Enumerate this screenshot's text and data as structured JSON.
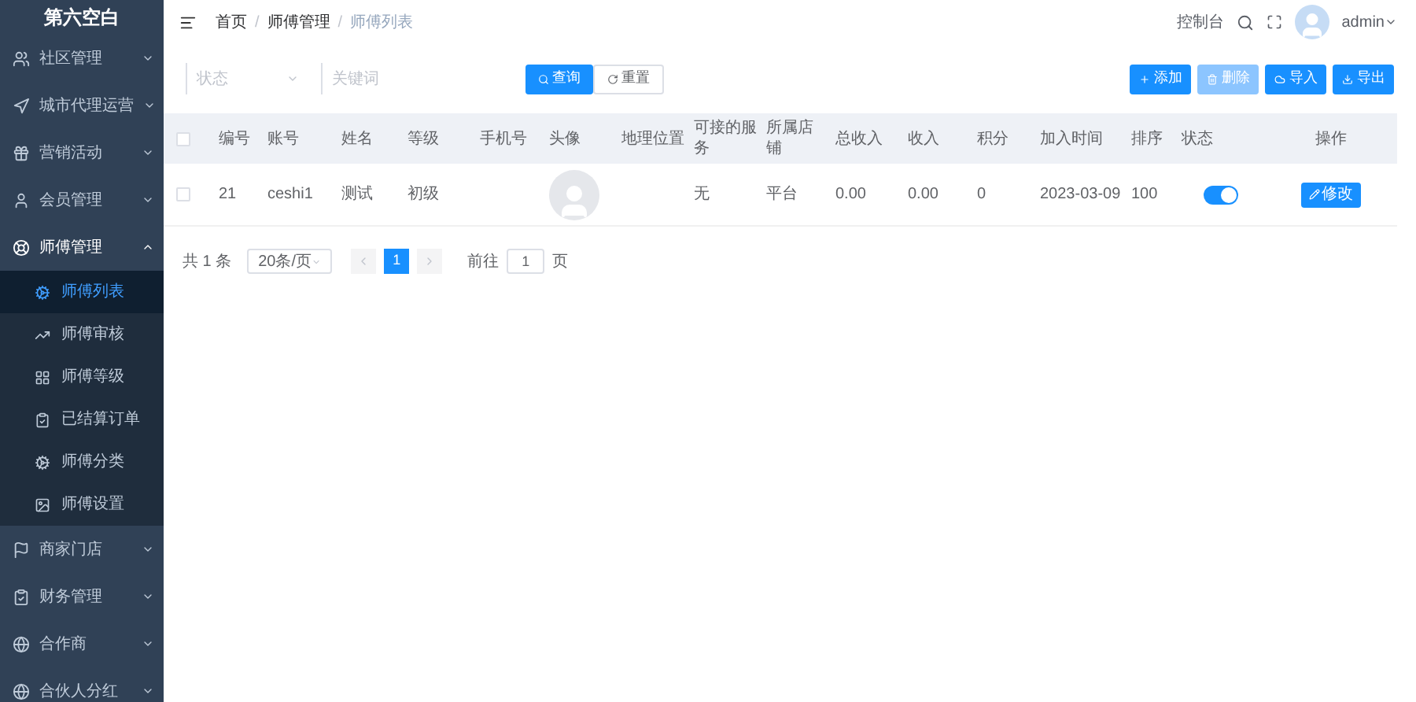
{
  "logo": "第六空白",
  "sidebar": {
    "items": [
      {
        "label": "社区管理",
        "expanded": false
      },
      {
        "label": "城市代理运营",
        "expanded": false
      },
      {
        "label": "营销活动",
        "expanded": false
      },
      {
        "label": "会员管理",
        "expanded": false
      },
      {
        "label": "师傅管理",
        "expanded": true,
        "children": [
          {
            "label": "师傅列表",
            "selected": true
          },
          {
            "label": "师傅审核",
            "selected": false
          },
          {
            "label": "师傅等级",
            "selected": false
          },
          {
            "label": "已结算订单",
            "selected": false
          },
          {
            "label": "师傅分类",
            "selected": false
          },
          {
            "label": "师傅设置",
            "selected": false
          }
        ]
      },
      {
        "label": "商家门店",
        "expanded": false
      },
      {
        "label": "财务管理",
        "expanded": false
      },
      {
        "label": "合作商",
        "expanded": false
      },
      {
        "label": "合伙人分红",
        "expanded": false
      }
    ]
  },
  "breadcrumb": {
    "separator": "/",
    "items": [
      "首页",
      "师傅管理",
      "师傅列表"
    ]
  },
  "header": {
    "console": "控制台",
    "user": "admin"
  },
  "filters": {
    "status_placeholder": "状态",
    "keyword_placeholder": "关键词"
  },
  "search_buttons": [
    {
      "label": "查询",
      "kind": "primary"
    },
    {
      "label": "重置",
      "kind": "plain"
    }
  ],
  "actions": [
    {
      "label": "添加",
      "disabled": false
    },
    {
      "label": "删除",
      "disabled": true
    },
    {
      "label": "导入",
      "disabled": false
    },
    {
      "label": "导出",
      "disabled": false
    }
  ],
  "table": {
    "header_checked": false,
    "columns": [
      "编号",
      "账号",
      "姓名",
      "等级",
      "手机号",
      "头像",
      "地理位置",
      "可接的服务",
      "所属店铺",
      "总收入",
      "收入",
      "积分",
      "加入时间",
      "排序",
      "状态",
      "操作"
    ],
    "rows": [
      {
        "checked": false,
        "cells": [
          {
            "kind": "text",
            "text": "21"
          },
          {
            "kind": "text",
            "text": "ceshi1"
          },
          {
            "kind": "text",
            "text": "测试"
          },
          {
            "kind": "text",
            "text": "初级"
          },
          {
            "kind": "blank"
          },
          {
            "kind": "avatar"
          },
          {
            "kind": "blank"
          },
          {
            "kind": "text",
            "text": "无"
          },
          {
            "kind": "text",
            "text": "平台"
          },
          {
            "kind": "text",
            "text": "0.00"
          },
          {
            "kind": "text",
            "text": "0.00"
          },
          {
            "kind": "text",
            "text": "0"
          },
          {
            "kind": "text",
            "text": "2023-03-09"
          },
          {
            "kind": "text",
            "text": "100"
          },
          {
            "kind": "switch",
            "on": true
          },
          {
            "kind": "button",
            "text": "修改"
          }
        ]
      }
    ]
  },
  "pagination": {
    "total": "共 1 条",
    "page_size": "20条/页",
    "pages": [
      {
        "label": "1",
        "selected": true
      }
    ],
    "goto_label": "前往",
    "goto_value": "1",
    "page_unit": "页"
  }
}
